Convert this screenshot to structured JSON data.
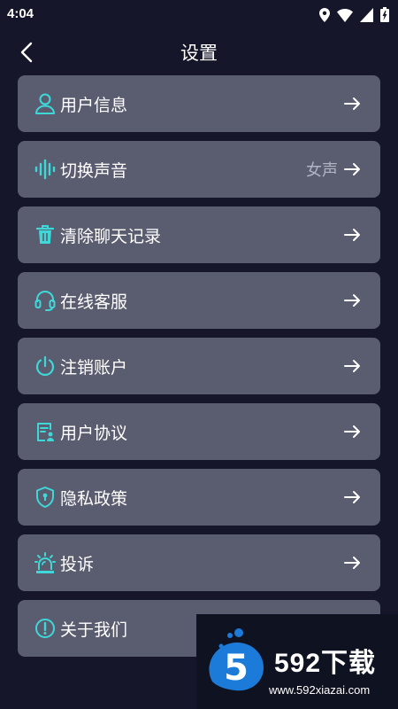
{
  "status_bar": {
    "time": "4:04"
  },
  "header": {
    "title": "设置"
  },
  "menu": [
    {
      "label": "用户信息",
      "icon": "user-icon"
    },
    {
      "label": "切换声音",
      "value": "女声",
      "icon": "sound-wave-icon"
    },
    {
      "label": "清除聊天记录",
      "icon": "trash-icon"
    },
    {
      "label": "在线客服",
      "icon": "headset-icon"
    },
    {
      "label": "注销账户",
      "icon": "power-icon"
    },
    {
      "label": "用户协议",
      "icon": "document-user-icon"
    },
    {
      "label": "隐私政策",
      "icon": "shield-lock-icon"
    },
    {
      "label": "投诉",
      "icon": "alarm-icon"
    },
    {
      "label": "关于我们",
      "icon": "info-icon"
    }
  ],
  "watermark": {
    "title": "592下载",
    "url": "www.592xiazai.com",
    "logo_text": "5"
  },
  "colors": {
    "background": "#15162a",
    "card": "#5a5d70",
    "accent": "#3fd8d8"
  }
}
